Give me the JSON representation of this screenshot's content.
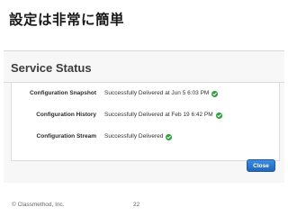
{
  "slide": {
    "title": "設定は非常に簡単",
    "copyright": "© Classmethod, Inc.",
    "page_number": "22"
  },
  "modal": {
    "title": "Service Status",
    "rows": [
      {
        "label": "Configuration Snapshot",
        "value": "Successfully Delivered at Jun 5 6:03 PM",
        "status_icon": "check-circle-icon"
      },
      {
        "label": "Configuration History",
        "value": "Successfully Delivered at Feb 19 6:42 PM",
        "status_icon": "check-circle-icon"
      },
      {
        "label": "Configuration Stream",
        "value": "Successfully Delivered",
        "status_icon": "check-circle-icon"
      }
    ],
    "close_label": "Close"
  },
  "colors": {
    "success": "#2e9e3e",
    "primary_button": "#2a75cc"
  }
}
